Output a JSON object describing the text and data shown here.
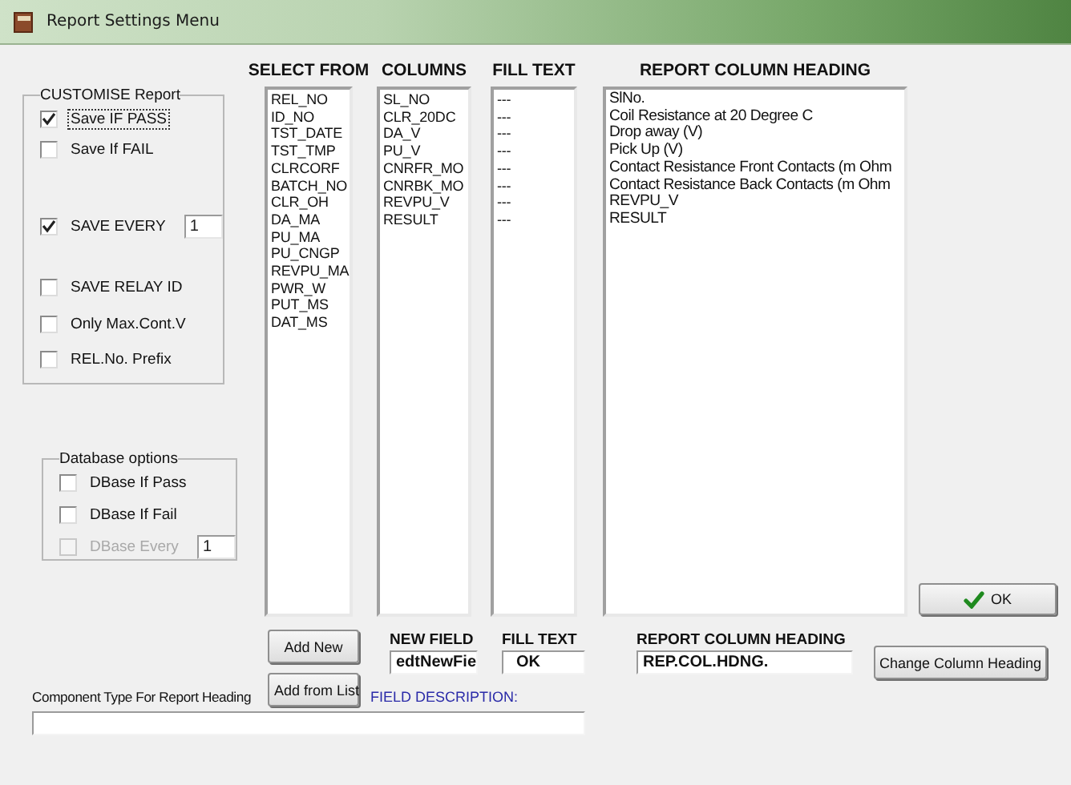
{
  "window": {
    "title": "Report Settings Menu"
  },
  "customise": {
    "title": "CUSTOMISE Report",
    "options": [
      {
        "label": "Save IF PASS",
        "checked": true,
        "focused": true
      },
      {
        "label": "Save If FAIL",
        "checked": false,
        "focused": false
      },
      {
        "label": "SAVE EVERY",
        "checked": true,
        "focused": false,
        "value": "1"
      },
      {
        "label": "SAVE RELAY ID",
        "checked": false,
        "focused": false
      },
      {
        "label": "Only Max.Cont.V",
        "checked": false,
        "focused": false
      },
      {
        "label": "REL.No. Prefix",
        "checked": false,
        "focused": false
      }
    ]
  },
  "database": {
    "title": "Database options",
    "options": [
      {
        "label": "DBase If Pass",
        "checked": false,
        "disabled": false
      },
      {
        "label": "DBase If Fail",
        "checked": false,
        "disabled": false
      },
      {
        "label": "DBase Every",
        "checked": false,
        "disabled": true,
        "value": "1"
      }
    ]
  },
  "lists": [
    {
      "heading": "SELECT FROM",
      "items": [
        "REL_NO",
        "ID_NO",
        "TST_DATE",
        "TST_TMP",
        "CLRCORF",
        "BATCH_NO",
        "CLR_OH",
        "DA_MA",
        "PU_MA",
        "PU_CNGP",
        "REVPU_MA",
        "PWR_W",
        "PUT_MS",
        "DAT_MS"
      ]
    },
    {
      "heading": "COLUMNS",
      "items": [
        "SL_NO",
        "CLR_20DC",
        "DA_V",
        "PU_V",
        "CNRFR_MO",
        "CNRBK_MO",
        "REVPU_V",
        "RESULT"
      ]
    },
    {
      "heading": "FILL TEXT",
      "items": [
        "---",
        "---",
        "---",
        "---",
        "---",
        "---",
        "---",
        "---"
      ]
    },
    {
      "heading": "REPORT COLUMN HEADING",
      "items": [
        "SlNo.",
        "Coil Resistance at 20 Degree C",
        "Drop away (V)",
        "Pick Up (V)",
        "Contact Resistance Front Contacts (m Ohm",
        "Contact Resistance Back Contacts (m Ohm",
        "REVPU_V",
        "RESULT"
      ]
    }
  ],
  "ok_button": "OK",
  "add_new_button": "Add New",
  "add_from_list_button": "Add from List",
  "new_field": {
    "label": "NEW FIELD",
    "value": "edtNewFie"
  },
  "fill_text": {
    "label": "FILL TEXT",
    "value": "OK"
  },
  "report_column_heading": {
    "label": "REPORT COLUMN HEADING",
    "value": "REP.COL.HDNG."
  },
  "change_heading_button": "Change Column Heading",
  "component_type": {
    "label": "Component Type For Report Heading"
  },
  "field_description": "FIELD DESCRIPTION:"
}
